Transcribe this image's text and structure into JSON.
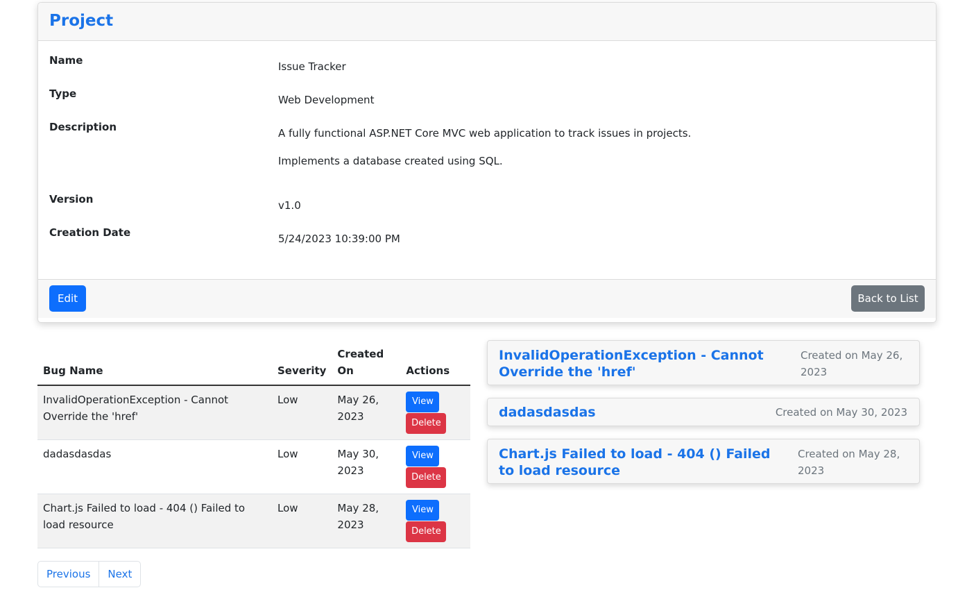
{
  "project": {
    "header_title": "Project",
    "fields": [
      {
        "label": "Name",
        "value": [
          "Issue Tracker"
        ]
      },
      {
        "label": "Type",
        "value": [
          "Web Development"
        ]
      },
      {
        "label": "Description",
        "value": [
          "A fully functional ASP.NET Core MVC web application to track issues in projects.",
          "Implements a database created using SQL."
        ]
      },
      {
        "label": "Version",
        "value": [
          "v1.0"
        ]
      },
      {
        "label": "Creation Date",
        "value": [
          "5/24/2023 10:39:00 PM"
        ]
      }
    ],
    "edit_label": "Edit",
    "back_label": "Back to List"
  },
  "bugs_table": {
    "headers": [
      "Bug Name",
      "Severity",
      "Created On",
      "Actions"
    ],
    "rows": [
      {
        "name": "InvalidOperationException - Cannot Override the 'href'",
        "severity": "Low",
        "created": "May 26, 2023",
        "view": "View",
        "delete": "Delete"
      },
      {
        "name": "dadasdasdas",
        "severity": "Low",
        "created": "May 30, 2023",
        "view": "View",
        "delete": "Delete"
      },
      {
        "name": "Chart.js Failed to load - 404 () Failed to load resource",
        "severity": "Low",
        "created": "May 28, 2023",
        "view": "View",
        "delete": "Delete"
      }
    ]
  },
  "pagination": {
    "previous": "Previous",
    "next": "Next"
  },
  "bug_cards": [
    {
      "title": "InvalidOperationException - Cannot Override the 'href'",
      "created": "Created on May 26, 2023"
    },
    {
      "title": "dadasdasdas",
      "created": "Created on May 30, 2023"
    },
    {
      "title": "Chart.js Failed to load - 404 () Failed to load resource",
      "created": "Created on May 28, 2023"
    }
  ],
  "colors": {
    "primary": "#0d6efd",
    "danger": "#dc3545",
    "secondary": "#6c757d",
    "link": "#1a73e8"
  }
}
